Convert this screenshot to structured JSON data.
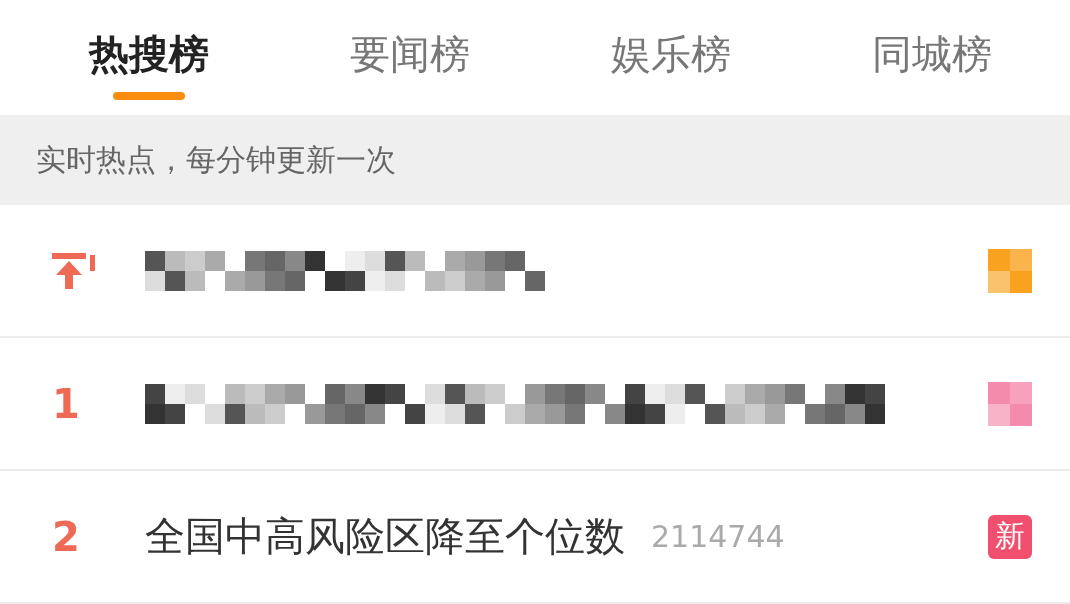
{
  "tabs": [
    {
      "label": "热搜榜",
      "selected": true
    },
    {
      "label": "要闻榜",
      "selected": false
    },
    {
      "label": "娱乐榜",
      "selected": false
    },
    {
      "label": "同城榜",
      "selected": false
    }
  ],
  "notice": "实时热点，每分钟更新一次",
  "rows": [
    {
      "kind": "pinned",
      "title_redacted": true,
      "badge": {
        "kind": "redacted",
        "color": "#f9a21f"
      }
    },
    {
      "kind": "ranked",
      "rank": "1",
      "title_redacted": true,
      "badge": {
        "kind": "redacted",
        "color": "#f48bac"
      }
    },
    {
      "kind": "ranked",
      "rank": "2",
      "title": "全国中高风险区降至个位数",
      "count": "2114744",
      "badge": {
        "kind": "text",
        "text": "新",
        "color": "#f0506e"
      }
    }
  ]
}
